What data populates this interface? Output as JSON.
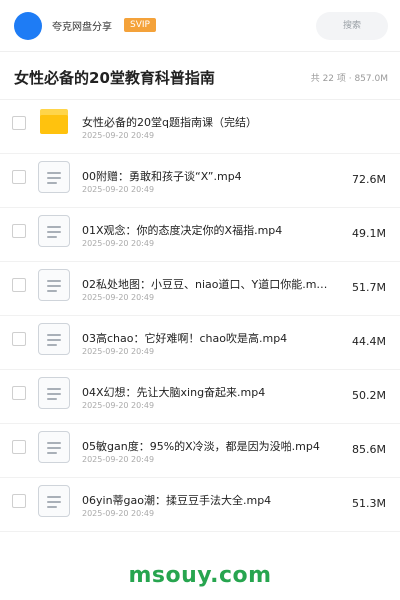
{
  "header": {
    "share_name": "夸克网盘分享",
    "badge": "SVIP",
    "search_placeholder": "搜索"
  },
  "title": "女性必备的20堂教育科普指南",
  "summary": "共 22 项 · 857.0M",
  "folder": {
    "name": "女性必备的20堂q题指南课（完结）",
    "date": "2025-09-20 20:49"
  },
  "files": [
    {
      "name": "00附赠：勇敢和孩子谈“X”.mp4",
      "date": "2025-09-20 20:49",
      "size": "72.6M"
    },
    {
      "name": "01X观念：你的态度决定你的X福指.mp4",
      "date": "2025-09-20 20:49",
      "size": "49.1M"
    },
    {
      "name": "02私处地图：小豆豆、niao道口、Y道口你能.m…",
      "date": "2025-09-20 20:49",
      "size": "51.7M"
    },
    {
      "name": "03高chao：它好难啊！chao吹是高.mp4",
      "date": "2025-09-20 20:49",
      "size": "44.4M"
    },
    {
      "name": "04X幻想：先让大脑xing奋起来.mp4",
      "date": "2025-09-20 20:49",
      "size": "50.2M"
    },
    {
      "name": "05敏gan度：95%的X冷淡，都是因为没啪.mp4",
      "date": "2025-09-20 20:49",
      "size": "85.6M"
    },
    {
      "name": "06yin蒂gao潮：揉豆豆手法大全.mp4",
      "date": "2025-09-20 20:49",
      "size": "51.3M"
    }
  ],
  "watermark": "msouy.com",
  "colors": {
    "accent": "#1e7cf5",
    "badge": "#f4a23a",
    "folder": "#ffc20e",
    "watermark": "#27a54f"
  }
}
